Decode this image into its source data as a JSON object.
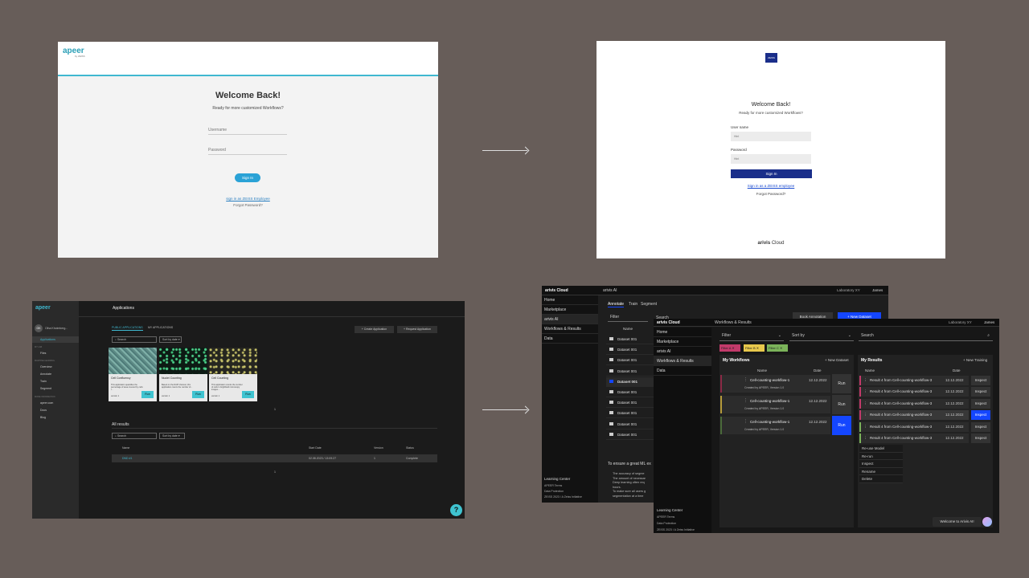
{
  "panel1": {
    "logo": "apeer",
    "logo_sub": "by ZEISS",
    "title": "Welcome Back!",
    "subtitle": "Ready for more customized Workflows?",
    "username_placeholder": "Username",
    "password_placeholder": "Password",
    "signin_label": "Sign In",
    "employee_link": "sign in as ZEISS Employee",
    "forgot_link": "Forgot Password?"
  },
  "panel2": {
    "logo": "ZEISS",
    "title": "Welcome Back!",
    "subtitle": "Ready for more customized Workflows?",
    "username_label": "User name",
    "username_placeholder": "Hint",
    "password_label": "Password",
    "password_placeholder": "Hint",
    "signin_label": "Sign In",
    "employee_link": "Sign in as a ZEISS employee",
    "forgot_link": "Forgot Password?",
    "brand_bold": "arivis",
    "brand_rest": " Cloud"
  },
  "panel3": {
    "logo": "apeer",
    "page_title": "Applications",
    "user_initials": "OK",
    "user_name": "Olha Kholmberg...",
    "sidebar": {
      "applications": "Applications",
      "my_lab_section": "MY LAB",
      "files": "Files",
      "ml_section": "MACHINE LEARNING",
      "overview": "Overview",
      "annotate": "Annotate",
      "train": "Train",
      "segment": "Segment",
      "more_section": "MORE INFORMATION",
      "apeer_com": "apeer.com",
      "docs": "Docs",
      "blog": "Blog"
    },
    "tabs": [
      "PUBLIC APPLICATIONS",
      "MY APPLICATIONS"
    ],
    "search_placeholder": "Search",
    "sort_label": "Sort by date",
    "create_app": "+ Create Application",
    "request_app": "+ Request Application",
    "cards": [
      {
        "title": "Cell Confluency",
        "desc": "This application quantifies the percentage of area covered by cells i...",
        "version": "version 1",
        "run": "Run"
      },
      {
        "title": "Nuclei Counting",
        "desc": "Based on the DAPI channel, this application counts the number of...",
        "version": "version 1",
        "run": "Run"
      },
      {
        "title": "Cell Counting",
        "desc": "This application counts the number of cells in brightfield microscopy images...",
        "version": "version 1",
        "run": "Run"
      }
    ],
    "page_number": "1",
    "all_results": "All results",
    "search2_placeholder": "Search",
    "sort2_label": "Sort by date",
    "table_headers": [
      "Name",
      "Start Date",
      "Version",
      "Status"
    ],
    "table_row": {
      "name": "DND #1",
      "date": "02.08.2023 / 13:09:27",
      "version": "1",
      "status": "Complete"
    },
    "page_number2": "1",
    "help": "?"
  },
  "panel4": {
    "brand": "arivis Cloud",
    "section": "arivis AI",
    "lab": "Laboratory XY",
    "user": "James",
    "sidebar": [
      "Home",
      "Marketplace",
      "arivis AI",
      "Workflows & Results",
      "Data"
    ],
    "tabs": [
      "Annotate",
      "Train",
      "Segment"
    ],
    "filter": "Filter",
    "search": "Search",
    "book_annotation": "Book Annotation",
    "new_dataset": "+ New Dataset",
    "col_name": "Name",
    "datasets": [
      "Dataset 001",
      "Dataset 001",
      "Dataset 001",
      "Dataset 001",
      "Dataset 001",
      "Dataset 001",
      "Dataset 001",
      "Dataset 001",
      "Dataset 001",
      "Dataset 001"
    ],
    "info_title": "To ensure a great ML ex",
    "bullets": [
      "The accuracy of segme",
      "The amount of necessar",
      "Deep learning often req",
      "hours.",
      "To make sure all users g",
      "segmentation at a time"
    ],
    "learning_center": "Learning Center",
    "footer": [
      "APEER Terms",
      "Data Protection",
      "ZEISS 2023 / A Zeiss Initiative"
    ]
  },
  "panel5": {
    "brand": "arivis Cloud",
    "section": "Workflows & Results",
    "lab": "Laboratory XY",
    "user": "James",
    "sidebar": [
      "Home",
      "Marketplace",
      "arivis AI",
      "Workflows & Results",
      "Data"
    ],
    "filter": "Filter",
    "sort": "Sort by",
    "search": "Search",
    "tags": [
      "Filter A",
      "Filter B",
      "Filter C"
    ],
    "my_workflows": "My Workflows",
    "new_dataset": "+ New Dataset",
    "col_name": "Name",
    "col_date": "Date",
    "workflows": [
      {
        "name": "Cell-counting-workflow-1",
        "created": "Created by APEER, Version 1.0",
        "date": "12.12.2022",
        "run": "Run"
      },
      {
        "name": "Cell-counting-workflow-1",
        "created": "Created by APEER, Version 1.0",
        "date": "12.12.2022",
        "run": "Run"
      },
      {
        "name": "Cell-counting-workflow-1",
        "created": "Created by APEER, Version 1.0",
        "date": "12.12.2022",
        "run": "Run"
      }
    ],
    "my_results": "My Results",
    "new_training": "+ New Training",
    "results": [
      {
        "name": "Result 4 from Cell-counting-workflow-3",
        "date": "12.12.2022",
        "action": "Inspect"
      },
      {
        "name": "Result 4 from Cell-counting-workflow-3",
        "date": "12.12.2022",
        "action": "Inspect"
      },
      {
        "name": "Result 4 from Cell-counting-workflow-3",
        "date": "12.12.2022",
        "action": "Inspect"
      },
      {
        "name": "Result 4 from Cell-counting-workflow-3",
        "date": "12.12.2022",
        "action": "Inspect"
      },
      {
        "name": "Result 4 from Cell-counting-workflow-3",
        "date": "12.12.2022",
        "action": "Inspect"
      },
      {
        "name": "Result 4 from Cell-counting-workflow-3",
        "date": "12.12.2022",
        "action": "Inspect"
      }
    ],
    "context_menu": [
      "Re-use Model",
      "Re-run",
      "Inspect",
      "Rename",
      "Delete"
    ],
    "learning_center": "Learning Center",
    "footer": [
      "APEER Terms",
      "Data Protection",
      "ZEISS 2023 / A Zeiss Initiative"
    ],
    "welcome": "Welcome to Arivis AI!"
  },
  "colors": {
    "background": "#675d59",
    "apeer_accent": "#3fb8d0",
    "zeiss_blue": "#1a2e8a",
    "arivis_blue": "#1446ff"
  }
}
